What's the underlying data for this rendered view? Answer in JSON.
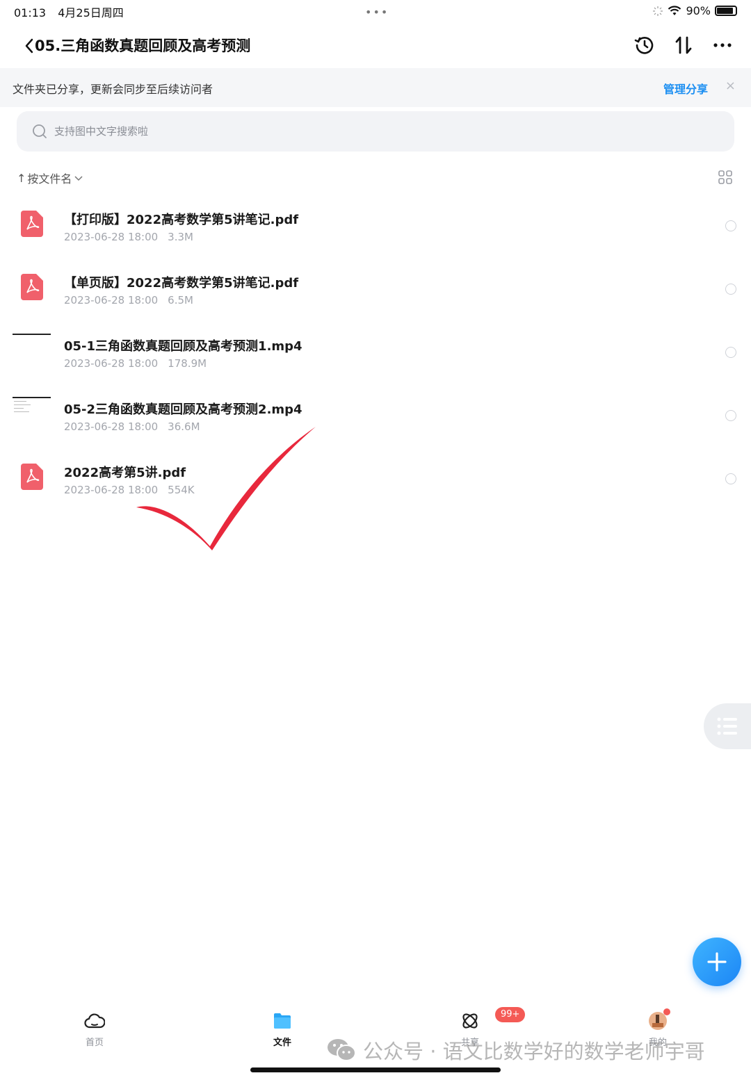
{
  "status_bar": {
    "time": "01:13",
    "date": "4月25日周四",
    "battery": "90%",
    "battery_level": 0.9
  },
  "nav": {
    "title": "05.三角函数真题回顾及高考预测"
  },
  "banner": {
    "text": "文件夹已分享，更新会同步至后续访问者",
    "action": "管理分享",
    "close": "×"
  },
  "search": {
    "placeholder": "支持图中文字搜索啦"
  },
  "sort": {
    "arrow": "↑",
    "label": "按文件名"
  },
  "files": [
    {
      "name": "【打印版】2022高考数学第5讲笔记.pdf",
      "date": "2023-06-28 18:00",
      "size": "3.3M",
      "type": "pdf"
    },
    {
      "name": "【单页版】2022高考数学第5讲笔记.pdf",
      "date": "2023-06-28 18:00",
      "size": "6.5M",
      "type": "pdf"
    },
    {
      "name": "05-1三角函数真题回顾及高考预测1.mp4",
      "date": "2023-06-28 18:00",
      "size": "178.9M",
      "type": "video"
    },
    {
      "name": "05-2三角函数真题回顾及高考预测2.mp4",
      "date": "2023-06-28 18:00",
      "size": "36.6M",
      "type": "video"
    },
    {
      "name": "2022高考第5讲.pdf",
      "date": "2023-06-28 18:00",
      "size": "554K",
      "type": "pdf"
    }
  ],
  "tabs": [
    {
      "label": "首页",
      "icon": "cloud-icon",
      "active": false
    },
    {
      "label": "文件",
      "icon": "folder-icon",
      "active": true
    },
    {
      "label": "共享",
      "icon": "share-icon",
      "active": false,
      "badge": "99+"
    },
    {
      "label": "我的",
      "icon": "avatar",
      "active": false
    }
  ],
  "watermark": {
    "text": "公众号 · 语文比数学好的数学老师宇哥"
  },
  "colors": {
    "accent": "#1c8ff2",
    "pdf": "#f0606b",
    "badge": "#f45a55",
    "check": "#e8283c"
  }
}
